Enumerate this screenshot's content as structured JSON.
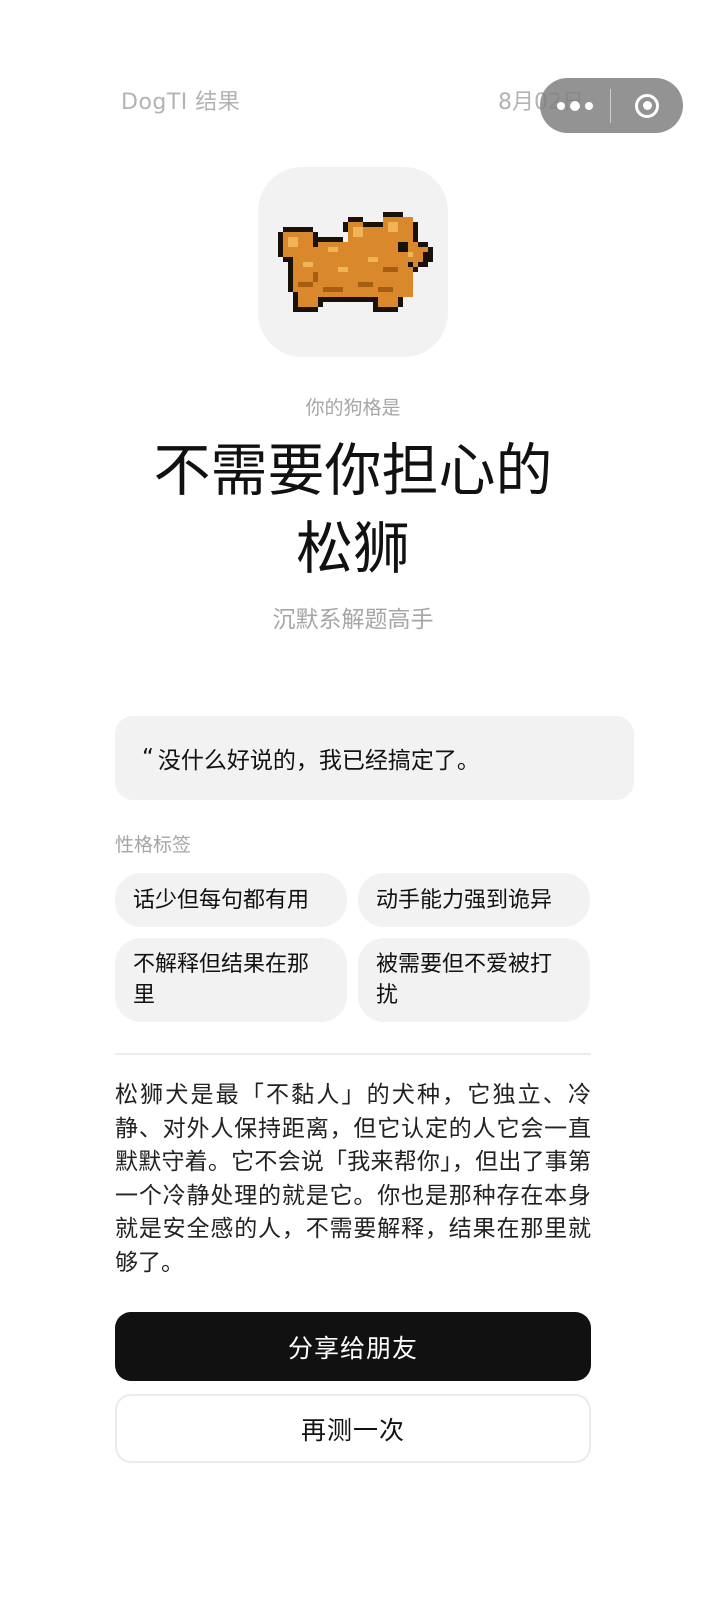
{
  "header": {
    "title": "DogTI 结果",
    "date": "8月02日"
  },
  "capsule": {
    "more_icon": "more-dots-icon",
    "close_icon": "target-close-icon"
  },
  "avatar": {
    "icon": "pixel-chow-chow-dog-icon"
  },
  "result": {
    "prefix": "你的狗格是",
    "title_line1": "不需要你担心的",
    "title_line2": "松狮",
    "subtitle": "沉默系解题高手"
  },
  "quote": {
    "mark": "“",
    "text": "没什么好说的，我已经搞定了。"
  },
  "tags": {
    "label": "性格标签",
    "items": [
      "话少但每句都有用",
      "动手能力强到诡异",
      "不解释但结果在那里",
      "被需要但不爱被打扰"
    ]
  },
  "description": "松狮犬是最「不黏人」的犬种，它独立、冷静、对外人保持距离，但它认定的人它会一直默默守着。它不会说「我来帮你」，但出了事第一个冷静处理的就是它。你也是那种存在本身就是安全感的人，不需要解释，结果在那里就够了。",
  "buttons": {
    "share": "分享给朋友",
    "retry": "再测一次"
  },
  "colors": {
    "primary_button": "#111111",
    "card_bg": "#f2f2f2",
    "muted_text": "#a6a6a6",
    "dog_fur": "#d9892b"
  }
}
